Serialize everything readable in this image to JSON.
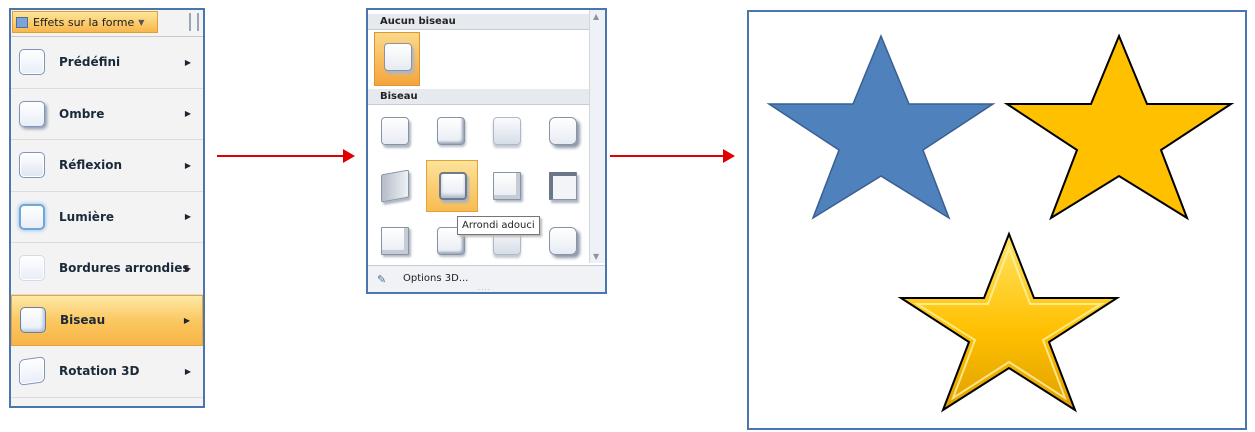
{
  "menu": {
    "button_label": "Effets sur la forme",
    "items": [
      {
        "label": "Prédéfini",
        "icon": "preset-icon"
      },
      {
        "label": "Ombre",
        "icon": "shadow-icon"
      },
      {
        "label": "Réflexion",
        "icon": "reflection-icon"
      },
      {
        "label": "Lumière",
        "icon": "glow-icon"
      },
      {
        "label": "Bordures arrondies",
        "icon": "soft-edges-icon"
      },
      {
        "label": "Biseau",
        "icon": "bevel-icon",
        "active": true
      },
      {
        "label": "Rotation 3D",
        "icon": "rotation-3d-icon"
      }
    ]
  },
  "gallery": {
    "section_none": "Aucun biseau",
    "section_bevel": "Biseau",
    "tooltip": "Arrondi adouci",
    "options_label": "Options 3D..."
  },
  "colors": {
    "accent_border": "#4a76ad",
    "arrow": "#e00000",
    "star_blue": "#4f81bd",
    "star_gold": "#ffc000"
  }
}
